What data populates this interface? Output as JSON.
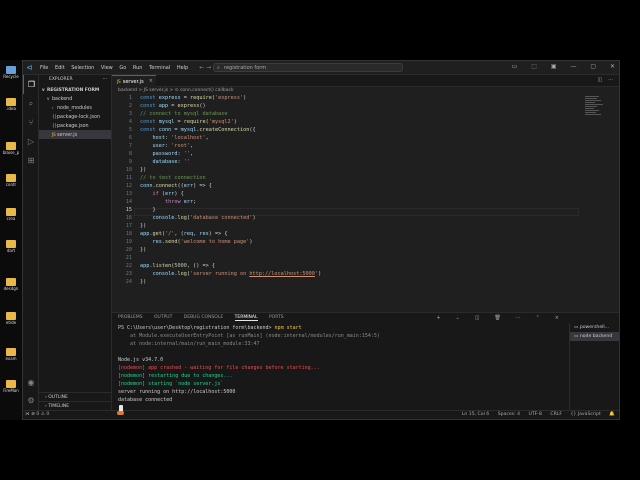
{
  "desktop": {
    "icons": [
      {
        "label": "Recycle",
        "color": "#6aa0d8"
      },
      {
        "label": ".idea",
        "color": "#e8b94a"
      },
      {
        "label": "blaise_p",
        "color": "#e8b94a"
      },
      {
        "label": "contr",
        "color": "#e8b94a"
      },
      {
        "label": "crea",
        "color": "#e8b94a"
      },
      {
        "label": "dart",
        "color": "#e8b94a"
      },
      {
        "label": "desdgn",
        "color": "#e8b94a"
      },
      {
        "label": "etide",
        "color": "#e8b94a"
      },
      {
        "label": "exam",
        "color": "#e8b94a"
      },
      {
        "label": "FireMan",
        "color": "#e8b94a"
      }
    ]
  },
  "titlebar": {
    "menu": [
      "File",
      "Edit",
      "Selection",
      "View",
      "Go",
      "Run",
      "Terminal",
      "Help"
    ],
    "nav": "←  →",
    "search": "registration form",
    "controls": [
      "▭",
      "⬚",
      "▣",
      "—",
      "▢",
      "✕"
    ]
  },
  "sidebar": {
    "header": "EXPLORER",
    "root": "REGISTRATION FORM",
    "items": [
      {
        "label": "backend",
        "icon": "v",
        "indent": 1
      },
      {
        "label": "node_modules",
        "icon": ">",
        "indent": 2
      },
      {
        "label": "package-lock.json",
        "icon": "{}",
        "indent": 2
      },
      {
        "label": "package.json",
        "icon": "{}",
        "indent": 2
      },
      {
        "label": "server.js",
        "icon": "JS",
        "indent": 2
      }
    ],
    "outline": "OUTLINE",
    "timeline": "TIMELINE"
  },
  "editor": {
    "tab_label": "server.js",
    "breadcrumb": "backend  >  JS server.js  >  ⊙ conn.connect() callback",
    "line_numbers": [
      "1",
      "2",
      "3",
      "4",
      "5",
      "6",
      "7",
      "8",
      "9",
      "10",
      "11",
      "12",
      "13",
      "14",
      "15",
      "16",
      "17",
      "18",
      "19",
      "20",
      "21",
      "22",
      "23",
      "24"
    ]
  },
  "panel": {
    "tabs": [
      "PROBLEMS",
      "OUTPUT",
      "DEBUG CONSOLE",
      "TERMINAL",
      "PORTS"
    ],
    "terminals": [
      "powershell...",
      "node backend"
    ],
    "lines": [
      "PS C:\\Users\\user\\Desktop\\registration form\\backend> npm start",
      "    at Module.executeUserEntryPoint [as runMain] (node:internal/modules/run_main:154:5)",
      "    at node:internal/main/run_main_module:33:47",
      "",
      "Node.js v34.7.0",
      "[nodemon] app crashed - waiting for file changes before starting...",
      "[nodemon] restarting due to changes...",
      "[nodemon] starting `node server.js`",
      "server running on http://localhost:5000",
      "database connected"
    ]
  },
  "status": {
    "left": "⊗ 0  ⚠ 0",
    "right": [
      "Ln 15, Col 6",
      "Spaces: 4",
      "UTF-8",
      "CRLF",
      "{} JavaScript",
      "🔔"
    ]
  }
}
